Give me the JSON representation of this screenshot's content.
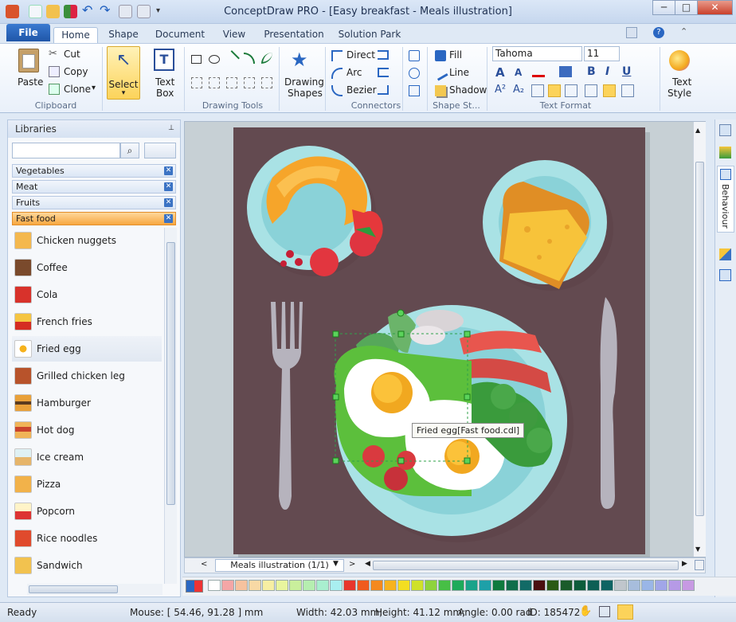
{
  "window": {
    "title": "ConceptDraw PRO - [Easy breakfast - Meals illustration]",
    "minimize": "─",
    "maximize": "□",
    "close": "✕"
  },
  "tabs": {
    "file": "File",
    "items": [
      "Home",
      "Shape",
      "Document",
      "View",
      "Presentation",
      "Solution Park"
    ]
  },
  "ribbon": {
    "clipboard": {
      "paste": "Paste",
      "cut": "Cut",
      "copy": "Copy",
      "clone": "Clone",
      "clone_arrow": "▾",
      "label": "Clipboard"
    },
    "select": {
      "label": "Select",
      "arrow": "▾"
    },
    "textbox": {
      "line1": "Text",
      "line2": "Box"
    },
    "drawing_tools": {
      "label": "Drawing Tools"
    },
    "drawing_shapes": {
      "line1": "Drawing",
      "line2": "Shapes"
    },
    "connectors": {
      "direct": "Direct",
      "arc": "Arc",
      "bezier": "Bezier",
      "label": "Connectors"
    },
    "shape_style": {
      "fill": "Fill",
      "line": "Line",
      "shadow": "Shadow",
      "label": "Shape St..."
    },
    "text_format": {
      "font": "Tahoma",
      "size": "11",
      "bold": "B",
      "italic": "I",
      "underline": "U",
      "grow": "A",
      "shrink": "A",
      "sup": "A²",
      "sub": "A₂",
      "label": "Text Format"
    },
    "text_style": {
      "line1": "Text",
      "line2": "Style"
    }
  },
  "libraries": {
    "title": "Libraries",
    "pin": "📌",
    "search_placeholder": "",
    "tags": [
      "Vegetables",
      "Meat",
      "Fruits",
      "Fast food"
    ],
    "items": [
      "Chicken nuggets",
      "Coffee",
      "Cola",
      "French fries",
      "Fried egg",
      "Grilled chicken leg",
      "Hamburger",
      "Hot dog",
      "Ice cream",
      "Pizza",
      "Popcorn",
      "Rice noodles",
      "Sandwich"
    ]
  },
  "right_panel": {
    "behaviour": "Behaviour"
  },
  "canvas": {
    "tooltip": "Fried egg[Fast food.cdl]",
    "page_selector": "Meals illustration (1/1)"
  },
  "palette": [
    "#ffffff",
    "#f4a6a6",
    "#f6c29e",
    "#f8d9a5",
    "#f7efa3",
    "#e9f59e",
    "#c9ef9c",
    "#b6eeb0",
    "#a9efcf",
    "#a9eff0",
    "#e8362c",
    "#f05a1e",
    "#f5891e",
    "#f7b31e",
    "#f3de21",
    "#cfe12a",
    "#8fd33c",
    "#47bf45",
    "#1eaa5a",
    "#1aa38a",
    "#1ea0a8",
    "#0f7a3d",
    "#0f6d4a",
    "#126a66",
    "#4a0f0f",
    "#2a5a14",
    "#1a5b2a",
    "#0d5c3b",
    "#0e5f55",
    "#0e6463",
    "#c0c6cc",
    "#a7bddc",
    "#9ab6e7",
    "#a1a6e8",
    "#b69ae6",
    "#c79ae3"
  ],
  "status": {
    "ready": "Ready",
    "mouse": "Mouse: [ 54.46, 91.28 ] mm",
    "width": "Width: 42.03 mm;",
    "height": "Height: 41.12 mm;",
    "angle": "Angle: 0.00 rad",
    "id": "ID: 185472"
  }
}
